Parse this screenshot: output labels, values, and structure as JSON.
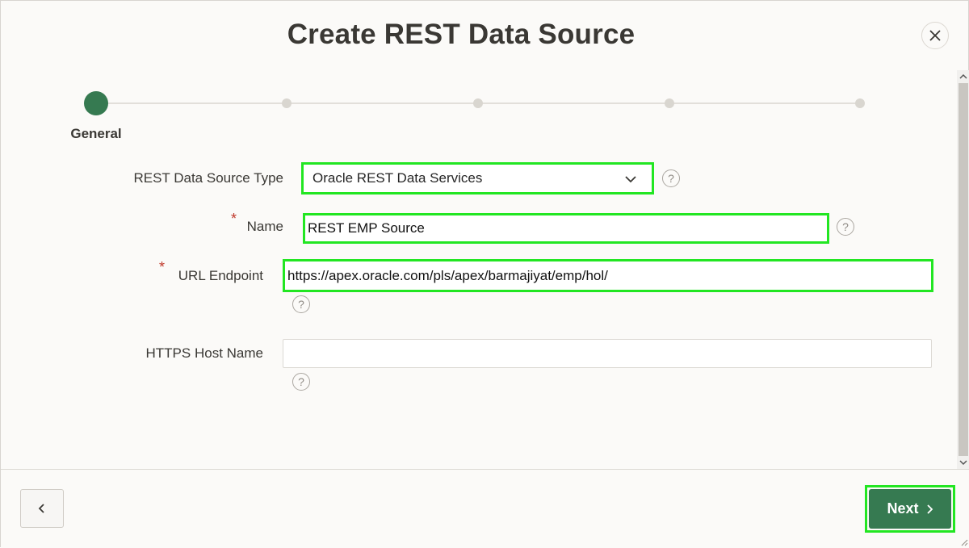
{
  "dialog": {
    "title": "Create REST Data Source",
    "close_icon": "close-icon"
  },
  "wizard": {
    "steps": [
      {
        "label": "General",
        "active": true
      },
      {
        "label": "",
        "active": false
      },
      {
        "label": "",
        "active": false
      },
      {
        "label": "",
        "active": false
      },
      {
        "label": "",
        "active": false
      }
    ]
  },
  "form": {
    "source_type": {
      "label": "REST Data Source Type",
      "value": "Oracle REST Data Services",
      "required": false
    },
    "name": {
      "label": "Name",
      "value": "REST EMP Source",
      "required": true
    },
    "url_endpoint": {
      "label": "URL Endpoint",
      "value": "https://apex.oracle.com/pls/apex/barmajiyat/emp/hol/",
      "required": true
    },
    "https_host": {
      "label": "HTTPS Host Name",
      "value": "",
      "required": false
    },
    "required_marker": "*",
    "help_glyph": "?"
  },
  "footer": {
    "back_icon": "chevron-left-icon",
    "next_label": "Next",
    "next_icon": "chevron-right-icon"
  },
  "colors": {
    "accent": "#367a51",
    "highlight": "#22e622",
    "required": "#c0392b"
  }
}
